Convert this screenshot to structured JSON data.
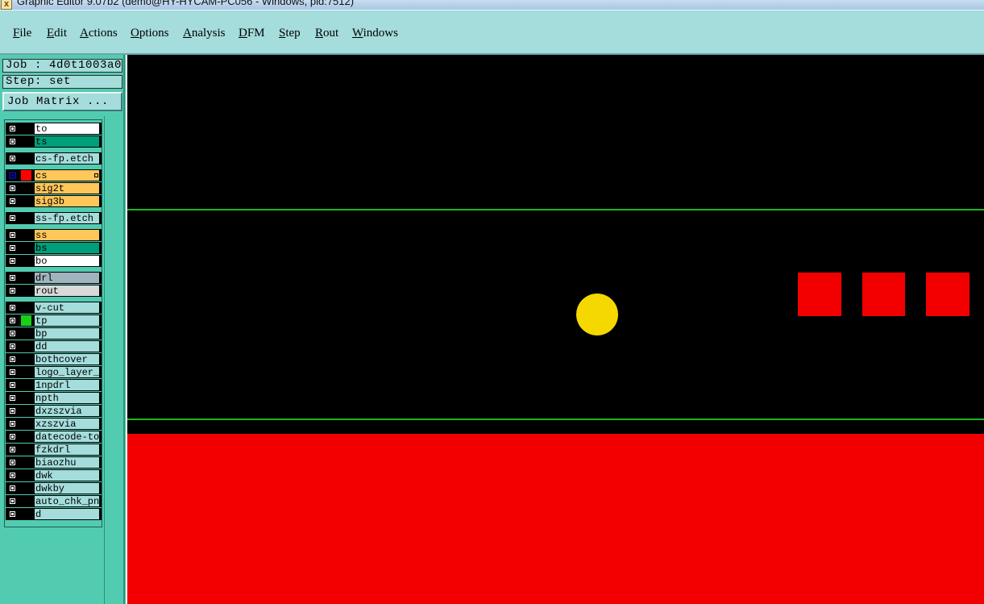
{
  "window": {
    "title": "Graphic Editor 9.07b2 (demo@HY-HYCAM-PC056 - Windows, pid:7512)",
    "icon": "x-icon"
  },
  "menu": [
    {
      "label": "File"
    },
    {
      "label": "Edit"
    },
    {
      "label": "Actions"
    },
    {
      "label": "Options"
    },
    {
      "label": "Analysis"
    },
    {
      "label": "DFM"
    },
    {
      "label": "Step"
    },
    {
      "label": "Rout"
    },
    {
      "label": "Windows"
    }
  ],
  "panel": {
    "job_label": "Job : 4d0t1003a0",
    "step_label": "Step: set",
    "job_matrix_button": "Job Matrix ..."
  },
  "layers": [
    {
      "name": "to",
      "color": "#ffffff",
      "swatch": ""
    },
    {
      "name": "ts",
      "color": "#009e7a",
      "swatch": ""
    },
    {
      "name": "cs-fp.etch",
      "color": "#a5dcdc",
      "swatch": ""
    },
    {
      "name": "cs",
      "color": "#ffc65a",
      "swatch": "#ff0000",
      "active": true
    },
    {
      "name": "sig2t",
      "color": "#ffc65a",
      "swatch": ""
    },
    {
      "name": "sig3b",
      "color": "#ffc65a",
      "swatch": ""
    },
    {
      "name": "ss-fp.etch",
      "color": "#a5dcdc",
      "swatch": ""
    },
    {
      "name": "ss",
      "color": "#ffc65a",
      "swatch": ""
    },
    {
      "name": "bs",
      "color": "#009e7a",
      "swatch": ""
    },
    {
      "name": "bo",
      "color": "#ffffff",
      "swatch": ""
    },
    {
      "name": "drl",
      "color": "#9fb4bf",
      "swatch": ""
    },
    {
      "name": "rout",
      "color": "#d9d9d9",
      "swatch": ""
    },
    {
      "name": "v-cut",
      "color": "#a5dcdc",
      "swatch": ""
    },
    {
      "name": "tp",
      "color": "#a5dcdc",
      "swatch": "#19d019"
    },
    {
      "name": "bp",
      "color": "#a5dcdc",
      "swatch": ""
    },
    {
      "name": "dd",
      "color": "#a5dcdc",
      "swatch": ""
    },
    {
      "name": "bothcover",
      "color": "#a5dcdc",
      "swatch": ""
    },
    {
      "name": "logo_layer_t",
      "color": "#a5dcdc",
      "swatch": ""
    },
    {
      "name": "1npdrl",
      "color": "#a5dcdc",
      "swatch": ""
    },
    {
      "name": "npth",
      "color": "#a5dcdc",
      "swatch": ""
    },
    {
      "name": "dxzszvia",
      "color": "#a5dcdc",
      "swatch": ""
    },
    {
      "name": "xzszvia",
      "color": "#a5dcdc",
      "swatch": ""
    },
    {
      "name": "datecode-to",
      "color": "#a5dcdc",
      "swatch": ""
    },
    {
      "name": "fzkdrl",
      "color": "#a5dcdc",
      "swatch": ""
    },
    {
      "name": "biaozhu",
      "color": "#a5dcdc",
      "swatch": ""
    },
    {
      "name": "dwk",
      "color": "#a5dcdc",
      "swatch": ""
    },
    {
      "name": "dwkby",
      "color": "#a5dcdc",
      "swatch": ""
    },
    {
      "name": "auto_chk_pnl",
      "color": "#a5dcdc",
      "swatch": ""
    },
    {
      "name": "d",
      "color": "#a5dcdc",
      "swatch": ""
    }
  ],
  "canvas_colors": {
    "background": "#000000",
    "profile_line": "#1eb41e",
    "copper": "#f20000",
    "pad": "#f5d800"
  }
}
